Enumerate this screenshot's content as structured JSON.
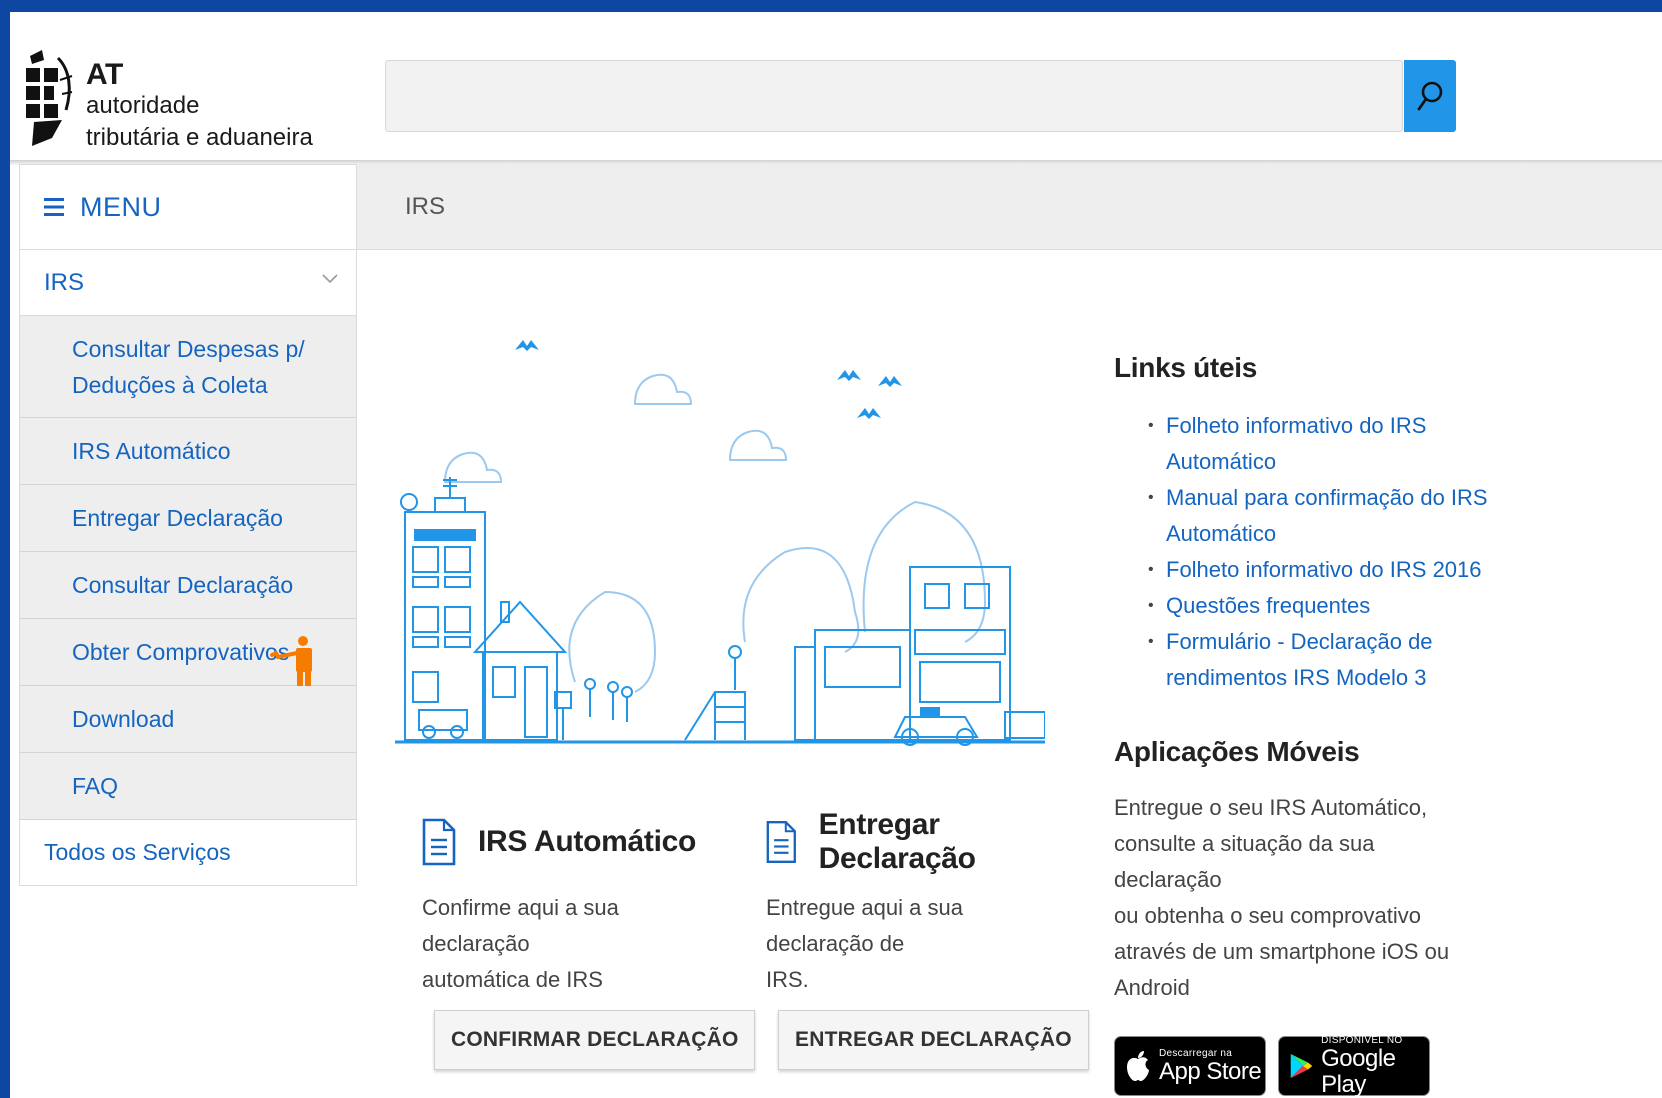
{
  "header": {
    "logo_abbrev": "AT",
    "logo_line1": "autoridade",
    "logo_line2": "tributária e aduaneira",
    "search_value": ""
  },
  "sidebar": {
    "menu_label": "MENU",
    "section_label": "IRS",
    "items": [
      {
        "label_line1": "Consultar Despesas p/",
        "label_line2": "Deduções à Coleta"
      },
      {
        "label": "IRS Automático"
      },
      {
        "label": "Entregar Declaração"
      },
      {
        "label": "Consultar Declaração"
      },
      {
        "label": "Obter Comprovativos"
      },
      {
        "label": "Download"
      },
      {
        "label": "FAQ"
      }
    ],
    "all_services": "Todos os Serviços"
  },
  "breadcrumb": "IRS",
  "cards": [
    {
      "title": "IRS Automático",
      "desc_line1": "Confirme aqui a sua declaração",
      "desc_line2": "automática de IRS",
      "button": "CONFIRMAR DECLARAÇÃO",
      "icon": "document-icon"
    },
    {
      "title": "Entregar Declaração",
      "desc_line1": "Entregue aqui a sua declaração de",
      "desc_line2": "IRS.",
      "button": "ENTREGAR DECLARAÇÃO",
      "icon": "document-icon"
    }
  ],
  "links": {
    "title": "Links úteis",
    "items": [
      {
        "line1": "Folheto informativo do IRS",
        "line2": "Automático"
      },
      {
        "line1": "Manual para confirmação do IRS",
        "line2": "Automático"
      },
      {
        "line1": "Folheto informativo do IRS 2016",
        "line2": ""
      },
      {
        "line1": "Questões frequentes",
        "line2": ""
      },
      {
        "line1": "Formulário - Declaração de",
        "line2": "rendimentos IRS Modelo 3"
      }
    ]
  },
  "apps": {
    "title": "Aplicações Móveis",
    "desc_lines": [
      "Entregue o seu IRS Automático,",
      "consulte a situação da sua declaração",
      "ou obtenha o seu comprovativo",
      "através de um smartphone iOS ou",
      "Android"
    ],
    "appstore_small": "Descarregar na",
    "appstore_big": "App Store",
    "googleplay_small": "DISPONÍVEL NO",
    "googleplay_big": "Google Play"
  },
  "colors": {
    "frame": "#0d47a1",
    "accent": "#2196e8",
    "link": "#1565c0",
    "pointer_figure": "#f57c00"
  }
}
